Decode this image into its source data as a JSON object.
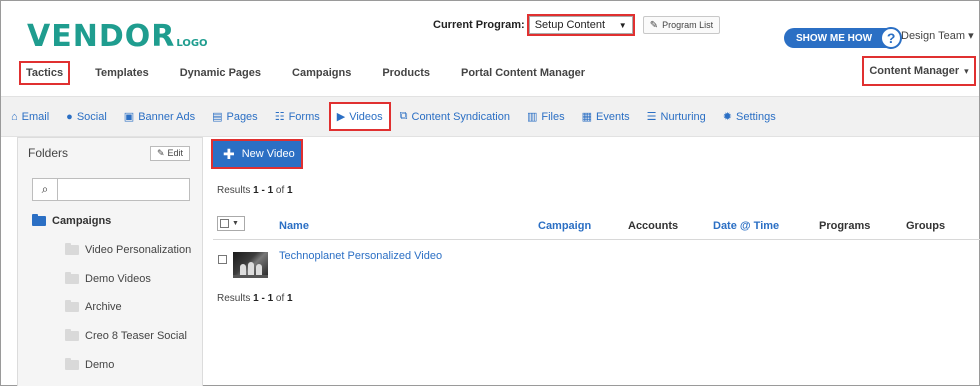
{
  "logo": {
    "main": "VENDOR",
    "suffix": "LOGO",
    "color": "#1f9d8f"
  },
  "program": {
    "label": "Current Program:",
    "selected": "Setup Content",
    "list_button": "Program List"
  },
  "help": {
    "show_me": "SHOW ME HOW",
    "question": "?"
  },
  "user": {
    "team": "Design Team",
    "caret": "▾"
  },
  "main_nav": {
    "items": [
      "Tactics",
      "Templates",
      "Dynamic Pages",
      "Campaigns",
      "Products",
      "Portal Content Manager"
    ],
    "right": "Content Manager",
    "right_caret": "▾"
  },
  "sub_nav": {
    "items": [
      {
        "label": "Email",
        "icon": "email-icon",
        "glyph": "⌂"
      },
      {
        "label": "Social",
        "icon": "social-icon",
        "glyph": "●"
      },
      {
        "label": "Banner Ads",
        "icon": "banner-ads-icon",
        "glyph": "▣"
      },
      {
        "label": "Pages",
        "icon": "pages-icon",
        "glyph": "▤"
      },
      {
        "label": "Forms",
        "icon": "forms-icon",
        "glyph": "☷"
      },
      {
        "label": "Videos",
        "icon": "videos-icon",
        "glyph": "▶"
      },
      {
        "label": "Content Syndication",
        "icon": "syndication-icon",
        "glyph": "⧉"
      },
      {
        "label": "Files",
        "icon": "files-icon",
        "glyph": "▥"
      },
      {
        "label": "Events",
        "icon": "events-icon",
        "glyph": "▦"
      },
      {
        "label": "Nurturing",
        "icon": "nurturing-icon",
        "glyph": "☰"
      },
      {
        "label": "Settings",
        "icon": "settings-icon",
        "glyph": "✹"
      }
    ],
    "active": "Videos",
    "accent": "#2b6fc4"
  },
  "folders": {
    "title": "Folders",
    "edit": "Edit",
    "search_value": "",
    "root": "Campaigns",
    "children": [
      "Video Personalization",
      "Demo Videos",
      "Archive",
      "Creo 8 Teaser Social",
      "Demo"
    ]
  },
  "videos": {
    "new_button": "New Video",
    "results_prefix": "Results ",
    "results_range": "1 - 1",
    "results_of": " of ",
    "results_total": "1",
    "columns": [
      "Name",
      "Campaign",
      "Accounts",
      "Date @ Time",
      "Programs",
      "Groups"
    ],
    "rows": [
      {
        "name": "Technoplanet Personalized Video"
      }
    ]
  },
  "highlight_color": "#e03030"
}
